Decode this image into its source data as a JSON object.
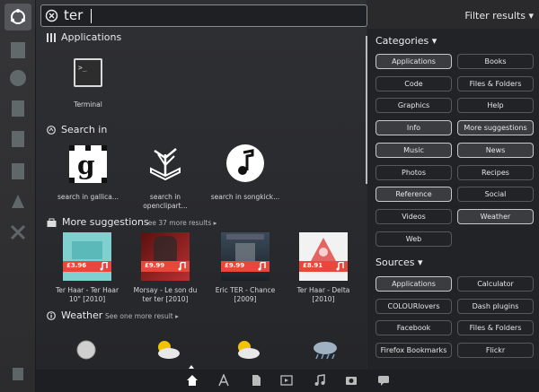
{
  "search": {
    "query": "ter"
  },
  "filter": {
    "label": "Filter results"
  },
  "sections": {
    "applications": {
      "title": "Applications",
      "items": [
        {
          "label": "Terminal"
        }
      ]
    },
    "search_in": {
      "title": "Search in",
      "items": [
        {
          "label": "search in gallica...",
          "icon": "gallica-icon"
        },
        {
          "label": "search in openclipart...",
          "icon": "openclipart-icon"
        },
        {
          "label": "search in songkick...",
          "icon": "songkick-icon"
        }
      ]
    },
    "more_suggestions": {
      "title": "More suggestions",
      "more": "See 37 more results",
      "items": [
        {
          "label": "Ter Haar - Ter Haar 10\" [2010]",
          "price": "£3.96",
          "color": "#7fd0cf"
        },
        {
          "label": "Morsay - Le son du ter ter [2010]",
          "price": "£9.99",
          "color": "#8a1e1e"
        },
        {
          "label": "Eric TER - Chance [2009]",
          "price": "£9.99",
          "color": "#3a4a5a"
        },
        {
          "label": "Ter Haar - Delta [2010]",
          "price": "£8.91",
          "color": "#f2f2f2"
        }
      ]
    },
    "weather": {
      "title": "Weather",
      "more": "See one more result"
    }
  },
  "filters": {
    "categories": {
      "title": "Categories",
      "items": [
        {
          "label": "Applications",
          "active": true
        },
        {
          "label": "Books",
          "active": false
        },
        {
          "label": "Code",
          "active": false
        },
        {
          "label": "Files & Folders",
          "active": false
        },
        {
          "label": "Graphics",
          "active": false
        },
        {
          "label": "Help",
          "active": false
        },
        {
          "label": "Info",
          "active": true
        },
        {
          "label": "More suggestions",
          "active": true
        },
        {
          "label": "Music",
          "active": true
        },
        {
          "label": "News",
          "active": true
        },
        {
          "label": "Photos",
          "active": false
        },
        {
          "label": "Recipes",
          "active": false
        },
        {
          "label": "Reference",
          "active": true
        },
        {
          "label": "Social",
          "active": false
        },
        {
          "label": "Videos",
          "active": false
        },
        {
          "label": "Weather",
          "active": true
        },
        {
          "label": "Web",
          "active": false
        }
      ]
    },
    "sources": {
      "title": "Sources",
      "items": [
        {
          "label": "Applications",
          "active": true
        },
        {
          "label": "Calculator",
          "active": false
        },
        {
          "label": "COLOURlovers",
          "active": false
        },
        {
          "label": "Dash plugins",
          "active": false
        },
        {
          "label": "Facebook",
          "active": false
        },
        {
          "label": "Files & Folders",
          "active": false
        },
        {
          "label": "Firefox Bookmarks",
          "active": false
        },
        {
          "label": "Flickr",
          "active": false
        }
      ]
    }
  },
  "bottom_tabs": [
    {
      "icon": "home-icon",
      "active": true
    },
    {
      "icon": "applications-icon",
      "active": false
    },
    {
      "icon": "files-icon",
      "active": false
    },
    {
      "icon": "video-icon",
      "active": false
    },
    {
      "icon": "music-icon",
      "active": false
    },
    {
      "icon": "photos-icon",
      "active": false
    },
    {
      "icon": "social-icon",
      "active": false
    }
  ]
}
